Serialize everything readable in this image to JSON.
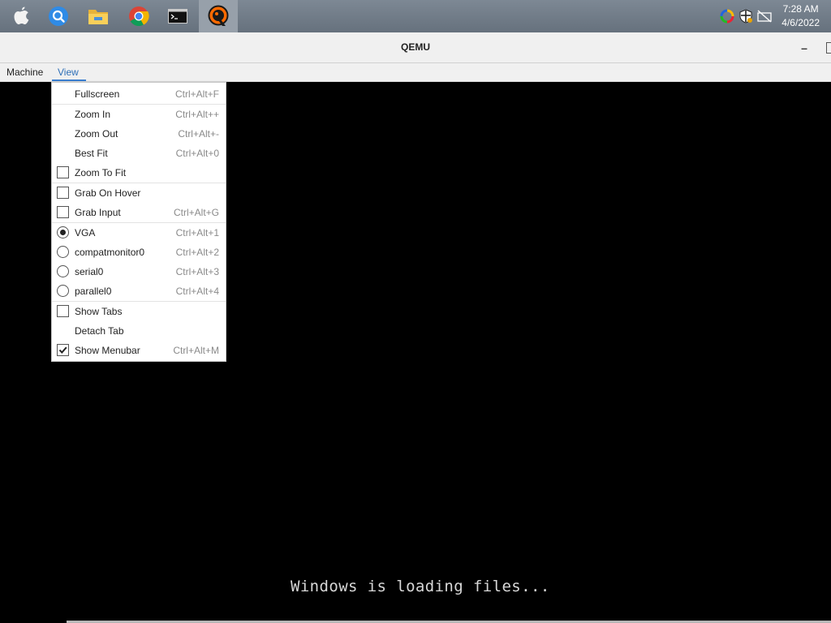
{
  "taskbar": {
    "icons": [
      {
        "name": "apple-icon"
      },
      {
        "name": "search-icon"
      },
      {
        "name": "file-explorer-icon"
      },
      {
        "name": "chrome-icon"
      },
      {
        "name": "terminal-icon"
      },
      {
        "name": "qemu-icon",
        "active": true
      }
    ],
    "clock_time": "7:28 AM",
    "clock_date": "4/6/2022"
  },
  "window": {
    "title": "QEMU"
  },
  "menubar": {
    "items": [
      {
        "label": "Machine"
      },
      {
        "label": "View",
        "active": true
      }
    ]
  },
  "view_menu": {
    "items": [
      {
        "label": "Fullscreen",
        "shortcut": "Ctrl+Alt+F",
        "type": "plain"
      },
      {
        "label": "Zoom In",
        "shortcut": "Ctrl+Alt++",
        "type": "plain"
      },
      {
        "label": "Zoom Out",
        "shortcut": "Ctrl+Alt+-",
        "type": "plain"
      },
      {
        "label": "Best Fit",
        "shortcut": "Ctrl+Alt+0",
        "type": "plain"
      },
      {
        "label": "Zoom To Fit",
        "shortcut": "",
        "type": "checkbox",
        "checked": false
      },
      {
        "label": "Grab On Hover",
        "shortcut": "",
        "type": "checkbox",
        "checked": false
      },
      {
        "label": "Grab Input",
        "shortcut": "Ctrl+Alt+G",
        "type": "checkbox",
        "checked": false
      },
      {
        "label": "VGA",
        "shortcut": "Ctrl+Alt+1",
        "type": "radio",
        "checked": true
      },
      {
        "label": "compatmonitor0",
        "shortcut": "Ctrl+Alt+2",
        "type": "radio",
        "checked": false
      },
      {
        "label": "serial0",
        "shortcut": "Ctrl+Alt+3",
        "type": "radio",
        "checked": false
      },
      {
        "label": "parallel0",
        "shortcut": "Ctrl+Alt+4",
        "type": "radio",
        "checked": false
      },
      {
        "label": "Show Tabs",
        "shortcut": "",
        "type": "checkbox",
        "checked": false
      },
      {
        "label": "Detach Tab",
        "shortcut": "",
        "type": "plain"
      },
      {
        "label": "Show Menubar",
        "shortcut": "Ctrl+Alt+M",
        "type": "checkbox",
        "checked": true
      }
    ]
  },
  "vm_screen": {
    "message": "Windows is loading files..."
  }
}
